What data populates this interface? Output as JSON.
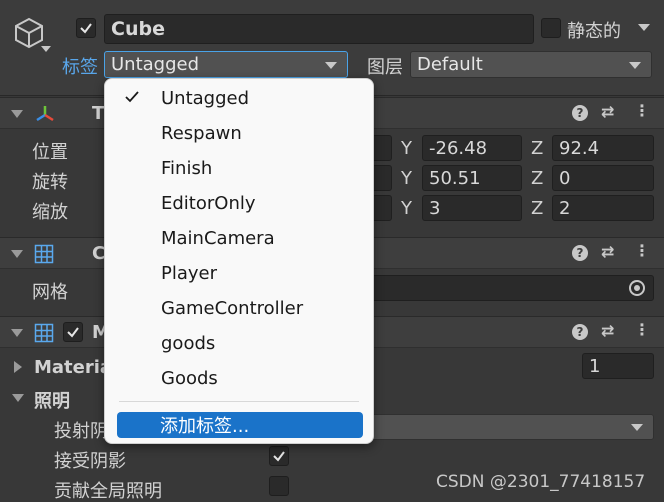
{
  "header": {
    "object_name": "Cube",
    "active_checked": true,
    "static_label": "静态的",
    "static_checked": false,
    "tag_label": "标签",
    "tag_value": "Untagged",
    "layer_label": "图层",
    "layer_value": "Default"
  },
  "transform": {
    "title_partial": "T",
    "rows": [
      {
        "label": "位置",
        "y": "-26.48",
        "z": "92.4"
      },
      {
        "label": "旋转",
        "y": "50.51",
        "z": "0"
      },
      {
        "label": "缩放",
        "y": "3",
        "z": "2"
      }
    ],
    "axis_y": "Y",
    "axis_z": "Z"
  },
  "mesh_filter": {
    "title_partial": "C",
    "mesh_label": "网格"
  },
  "mesh_renderer": {
    "title_partial": "M",
    "enabled": true,
    "materials_label": "Materia",
    "materials_count": "1",
    "lighting_label": "照明",
    "cast_shadows_label": "投射阴",
    "receive_shadows_label": "接受阴影",
    "receive_shadows_checked": true,
    "contribute_gi_label": "贡献全局照明",
    "contribute_gi_checked": false
  },
  "tag_menu": {
    "items": [
      "Untagged",
      "Respawn",
      "Finish",
      "EditorOnly",
      "MainCamera",
      "Player",
      "GameController",
      "goods",
      "Goods"
    ],
    "selected": "Untagged",
    "add_tag": "添加标签..."
  },
  "watermark": "CSDN @2301_77418157",
  "icons": [
    "cube-icon",
    "transform-axes-icon",
    "grid-icon",
    "help-icon",
    "preset-icon",
    "more-icon",
    "object-picker-icon",
    "checkmark-icon"
  ],
  "colors": {
    "background": "#383838",
    "accent": "#1a73c9",
    "tag_border": "#4aa3e8"
  }
}
